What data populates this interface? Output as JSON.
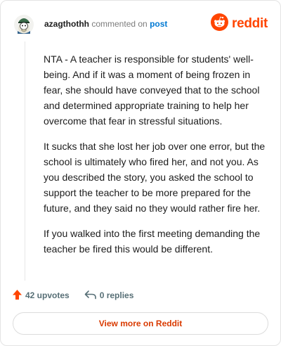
{
  "header": {
    "username": "azagthothh",
    "commented_on": "commented on",
    "post_link": "post",
    "brand": "reddit"
  },
  "comment": {
    "paragraphs": [
      "NTA - A teacher is responsible for students' well-being. And if it was a moment of being frozen in fear, she should have conveyed that to the school and determined appropriate training to help her overcome that fear in stressful situations.",
      "It sucks that she lost her job over one error, but the school is ultimately who fired her, and not you. As you described the story, you asked the school to support the teacher to be more prepared for the future, and they said no they would rather fire her.",
      "If you walked into the first meeting demanding the teacher be fired this would be different."
    ]
  },
  "actions": {
    "upvotes": "42 upvotes",
    "replies": "0 replies"
  },
  "footer": {
    "view_more": "View more on Reddit"
  },
  "colors": {
    "brand": "#ff4500",
    "link": "#0079d3",
    "view_more": "#d93a00"
  },
  "icons": {
    "avatar": "snoo-avatar",
    "logo": "reddit-snoo-icon",
    "upvote": "upvote-arrow-icon",
    "reply": "reply-arrow-icon"
  }
}
